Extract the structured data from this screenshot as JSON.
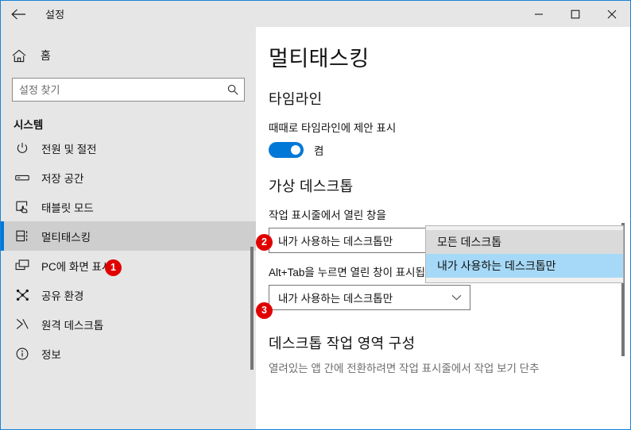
{
  "window": {
    "title": "설정",
    "back_icon": "back-arrow-icon",
    "controls": {
      "minimize": "minimize-icon",
      "maximize": "maximize-icon",
      "close": "close-icon"
    }
  },
  "sidebar": {
    "home": {
      "label": "홈",
      "icon": "home-icon"
    },
    "search": {
      "placeholder": "설정 찾기",
      "value": "",
      "icon": "search-icon"
    },
    "section_title": "시스템",
    "items": [
      {
        "label": "전원 및 절전",
        "icon": "power-icon",
        "selected": false
      },
      {
        "label": "저장 공간",
        "icon": "storage-icon",
        "selected": false
      },
      {
        "label": "태블릿 모드",
        "icon": "tablet-mode-icon",
        "selected": false
      },
      {
        "label": "멀티태스킹",
        "icon": "multitasking-icon",
        "selected": true
      },
      {
        "label": "PC에 화면 표시",
        "icon": "projecting-icon",
        "selected": false
      },
      {
        "label": "공유 환경",
        "icon": "shared-experiences-icon",
        "selected": false
      },
      {
        "label": "원격 데스크톱",
        "icon": "remote-desktop-icon",
        "selected": false
      },
      {
        "label": "정보",
        "icon": "info-icon",
        "selected": false
      }
    ]
  },
  "main": {
    "page_title": "멀티태스킹",
    "timeline": {
      "heading": "타임라인",
      "setting_label": "때때로 타임라인에 제안 표시",
      "toggle_state": "켬",
      "toggle_on": true
    },
    "virtual_desktop": {
      "heading": "가상 데스크톱",
      "taskbar_label": "작업 표시줄에서 열린 창을",
      "taskbar_value": "내가 사용하는 데스크톱만",
      "alttab_label": "Alt+Tab을 누르면 열린 창이 표시됩니다.",
      "alttab_value": "내가 사용하는 데스크톱만",
      "chevron_icon": "chevron-down-icon"
    },
    "snap": {
      "heading": "데스크톱 작업 영역 구성",
      "description": "열려있는 앱 간에 전환하려면 작업 표시줄에서 작업 보기 단추"
    }
  },
  "dropdown": {
    "options": [
      {
        "label": "모든 데스크톱",
        "state": "hover"
      },
      {
        "label": "내가 사용하는 데스크톱만",
        "state": "selected"
      }
    ]
  },
  "badges": [
    {
      "number": "1"
    },
    {
      "number": "2"
    },
    {
      "number": "3"
    }
  ],
  "colors": {
    "accent": "#0078d7",
    "badge": "#e00000",
    "selection": "#a6d9f7",
    "window_border": "#1883d7"
  }
}
